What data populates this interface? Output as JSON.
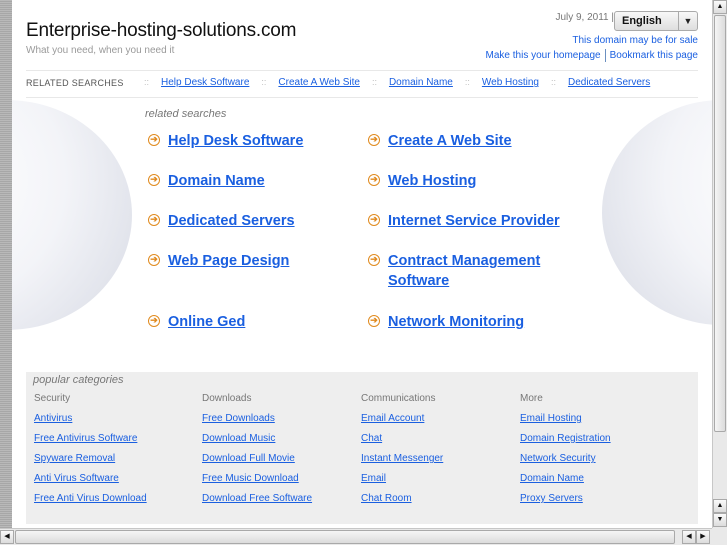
{
  "header": {
    "site_title": "Enterprise-hosting-solutions.com",
    "tagline": "What you need, when you need it",
    "date": "July 9, 2011 |",
    "language": "English",
    "sale_link": "This domain may be for sale",
    "homepage_link": "Make this your homepage",
    "bookmark_link": "Bookmark this page"
  },
  "related_bar": {
    "label": "RELATED SEARCHES",
    "separator": "::",
    "items": [
      "Help Desk Software",
      "Create A Web Site",
      "Domain Name",
      "Web Hosting",
      "Dedicated Servers"
    ]
  },
  "related_searches": {
    "heading": "related searches",
    "left": [
      "Help Desk Software",
      "Domain Name",
      "Dedicated Servers",
      "Web Page Design",
      "Online Ged"
    ],
    "right": [
      "Create A Web Site",
      "Web Hosting",
      "Internet Service Provider",
      "Contract Management Software",
      "Network Monitoring"
    ]
  },
  "popular_categories": {
    "heading": "popular categories",
    "columns": [
      {
        "title": "Security",
        "links": [
          "Antivirus",
          "Free Antivirus Software",
          "Spyware Removal",
          "Anti Virus Software",
          "Free Anti Virus Download"
        ]
      },
      {
        "title": "Downloads",
        "links": [
          "Free Downloads",
          "Download Music",
          "Download Full Movie",
          "Free Music Download",
          "Download Free Software"
        ]
      },
      {
        "title": "Communications",
        "links": [
          "Email Account",
          "Chat",
          "Instant Messenger",
          "Email",
          "Chat Room"
        ]
      },
      {
        "title": "More",
        "links": [
          "Email Hosting",
          "Domain Registration",
          "Network Security",
          "Domain Name",
          "Proxy Servers"
        ]
      }
    ]
  },
  "icons": {
    "bullet": "arrow-right-circle-icon",
    "scroll_up": "▲",
    "scroll_down": "▼",
    "scroll_left": "◀",
    "scroll_right": "▶",
    "dropdown": "▼"
  }
}
